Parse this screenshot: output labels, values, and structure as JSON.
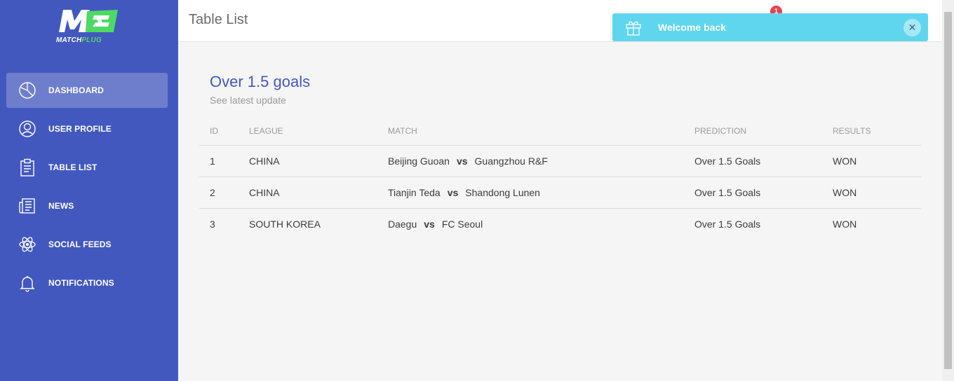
{
  "brand": {
    "logo_mark": "M",
    "logo_text_a": "MATCH",
    "logo_text_b": "PLUG",
    "accent": "#4cd964",
    "sidebar_bg": "#4358bf"
  },
  "sidebar": {
    "items": [
      {
        "label": "DASHBOARD",
        "icon": "pie-chart-icon",
        "active": true
      },
      {
        "label": "USER PROFILE",
        "icon": "user-icon",
        "active": false
      },
      {
        "label": "TABLE LIST",
        "icon": "clipboard-icon",
        "active": false
      },
      {
        "label": "NEWS",
        "icon": "newspaper-icon",
        "active": false
      },
      {
        "label": "SOCIAL FEEDS",
        "icon": "atom-icon",
        "active": false
      },
      {
        "label": "NOTIFICATIONS",
        "icon": "bell-icon",
        "active": false
      }
    ]
  },
  "header": {
    "title": "Table List",
    "notification_count": "1"
  },
  "toast": {
    "message": "Welcome back",
    "icon": "gift-icon",
    "close_icon": "close-icon",
    "color": "#5fd6ee"
  },
  "card": {
    "title": "Over 1.5 goals",
    "subtitle": "See latest update",
    "columns": [
      "ID",
      "LEAGUE",
      "MATCH",
      "PREDICTION",
      "RESULTS"
    ],
    "vs_label": "vs",
    "rows": [
      {
        "id": "1",
        "league": "CHINA",
        "home": "Beijing Guoan",
        "away": "Guangzhou R&F",
        "prediction": "Over 1.5 Goals",
        "result": "WON"
      },
      {
        "id": "2",
        "league": "CHINA",
        "home": "Tianjin Teda",
        "away": "Shandong Lunen",
        "prediction": "Over 1.5 Goals",
        "result": "WON"
      },
      {
        "id": "3",
        "league": "SOUTH KOREA",
        "home": "Daegu",
        "away": "FC Seoul",
        "prediction": "Over 1.5 Goals",
        "result": "WON"
      }
    ]
  }
}
